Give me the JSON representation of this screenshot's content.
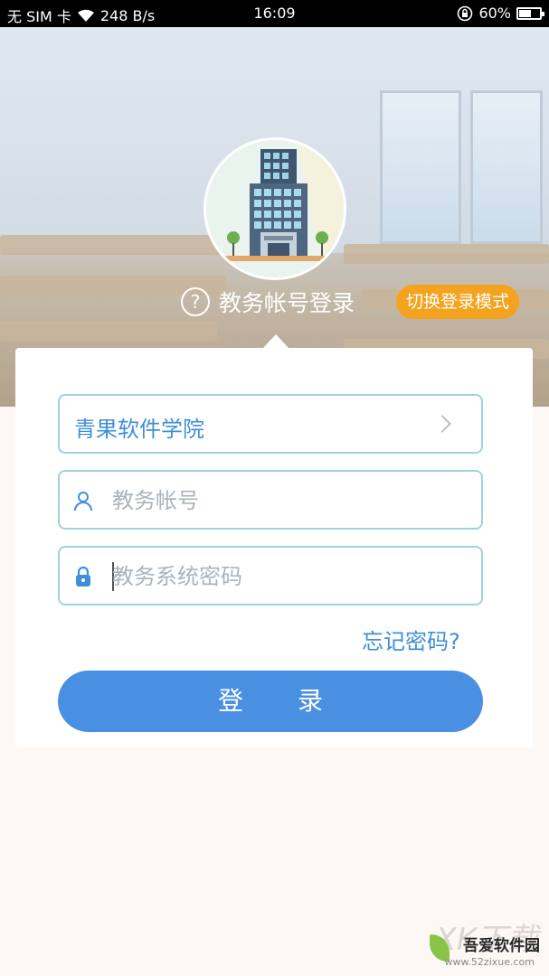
{
  "status_bar": {
    "sim": "无 SIM 卡",
    "speed": "248 B/s",
    "time": "16:09",
    "battery": "60%",
    "battery_level": 0.6
  },
  "header": {
    "title": "教务帐号登录",
    "switch_mode_label": "切换登录模式"
  },
  "form": {
    "school": "青果软件学院",
    "account_placeholder": "教务帐号",
    "password_placeholder": "教务系统密码",
    "forgot_label": "忘记密码?",
    "login_label_1": "登",
    "login_label_2": "录"
  },
  "watermark": {
    "big": "XK下载",
    "name": "吾爱软件园",
    "url": "www.52zixue.com"
  },
  "colors": {
    "accent": "#4a90e2",
    "link": "#3f8ed9",
    "switch_button": "#f3a31e",
    "field_border": "#9ed3df"
  },
  "icons": [
    "wifi-icon",
    "rotation-lock-icon",
    "battery-icon",
    "help-icon",
    "chevron-right-icon",
    "user-icon",
    "lock-icon"
  ]
}
